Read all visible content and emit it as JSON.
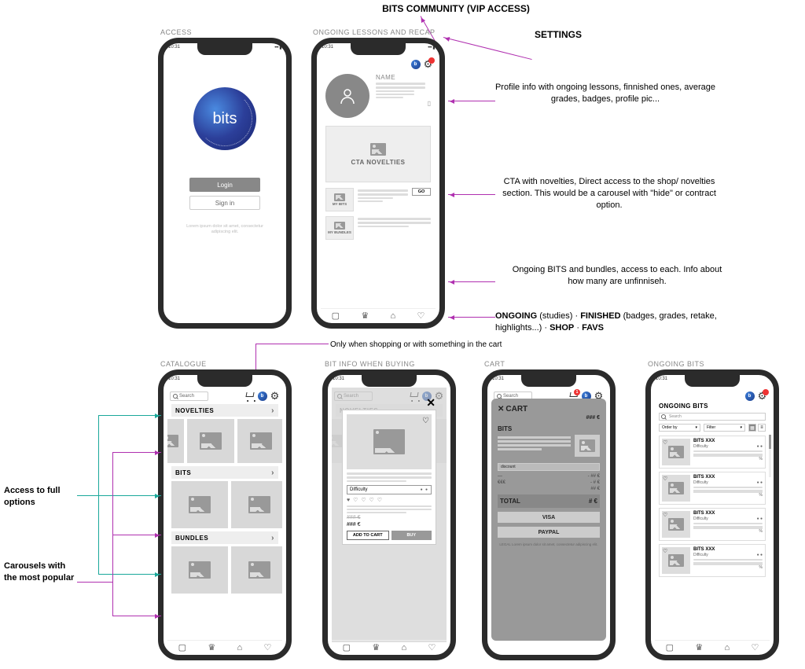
{
  "header_labels": {
    "community": "BITS COMMUNITY (VIP ACCESS)",
    "settings": "SETTINGS"
  },
  "screens": {
    "access": {
      "label": "ACCESS",
      "logo": "bits",
      "login": "Login",
      "signin": "Sign in",
      "lorem": "Lorem ipsum dolor sit amet, consectetur adipiscing elit."
    },
    "ongoing": {
      "label": "ONGOING LESSONS AND RECAP",
      "name_placeholder": "NAME",
      "cta": "CTA NOVELTIES",
      "my_bits": "MY BITS",
      "my_bundles": "MY BUNDLES",
      "go": "GO"
    },
    "catalogue": {
      "label": "CATALOGUE",
      "search": "Search",
      "novelties": "NOVELTIES",
      "bits": "BITS",
      "bundles": "BUNDLES"
    },
    "bit_info": {
      "label": "BIT INFO WHEN BUYING",
      "difficulty": "Difficulty",
      "price_old": "### €",
      "price_new": "### €",
      "add": "ADD TO CART",
      "buy": "BUY"
    },
    "cart": {
      "label": "CART",
      "title": "CART",
      "bits": "BITS",
      "price": "### €",
      "discount": "discount",
      "fee1": "- ## €",
      "fee2": "- # €",
      "sub1": "€€€",
      "sub2": "## €",
      "total_lbl": "TOTAL",
      "total_val": "# €",
      "visa": "VISA",
      "paypal": "PAYPAL",
      "legal": "LEGAL Lorem ipsum dolor sit amet, consectetur adipiscing elit."
    },
    "ongoing_bits": {
      "label": "ONGOING BITS",
      "title": "ONGOING BITS",
      "search": "Search",
      "order_by": "Order by",
      "filter": "Filter",
      "card_name": "BITS XXX",
      "difficulty": "Difficulty",
      "percent": "%"
    }
  },
  "status_bar": {
    "time": "10:31"
  },
  "common": {
    "search": "Search"
  },
  "annotations": {
    "profile": "Profile info with ongoing lessons, finnished ones, average grades, badges, profile pic...",
    "cta": "CTA with novelties, Direct access to the shop/ novelties section. This would be a carousel with \"hide\" or contract option.",
    "ongoing_access": "Ongoing BITS and bundles, access to each. Info about how many are unfinniseh.",
    "bottom_nav": "ONGOING (studies) · FINISHED (badges, grades, retake, highlights...) · SHOP · FAVS",
    "cart_note": "Only when shopping or with something in the cart",
    "full_options": "Access to full options",
    "carousels": "Carousels with the most popular"
  }
}
